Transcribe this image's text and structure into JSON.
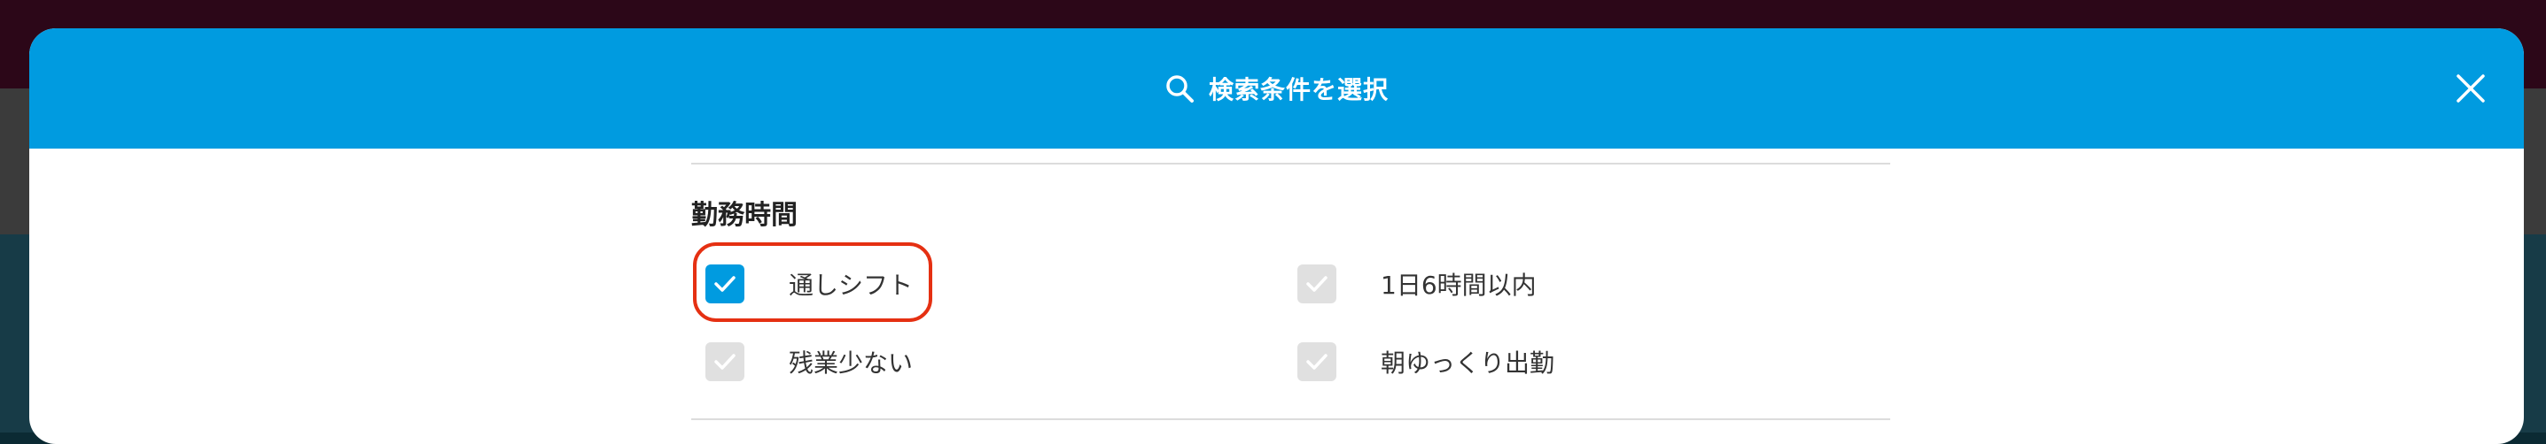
{
  "modal": {
    "title": "検索条件を選択",
    "header_color": "#009be0"
  },
  "section": {
    "title": "勤務時間",
    "options": [
      {
        "label": "通しシフト",
        "checked": true
      },
      {
        "label": "1日6時間以内",
        "checked": false
      },
      {
        "label": "残業少ない",
        "checked": false
      },
      {
        "label": "朝ゆっくり出勤",
        "checked": false
      }
    ]
  },
  "colors": {
    "accent": "#009be0",
    "checkbox_unchecked": "#e0e0e0",
    "highlight": "#e53012"
  },
  "icons": [
    "search-icon",
    "close-icon",
    "check-icon"
  ]
}
